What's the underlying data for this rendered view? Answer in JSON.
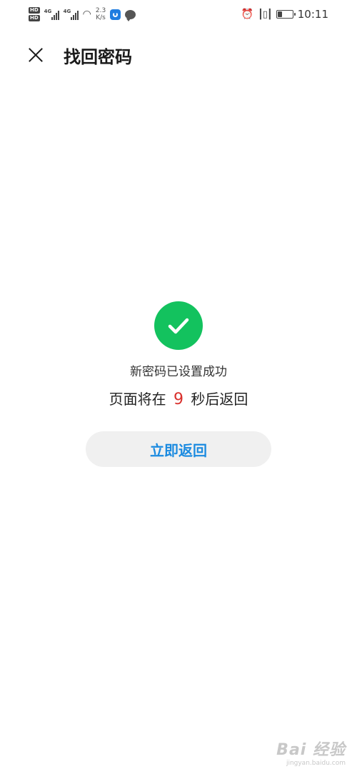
{
  "status_bar": {
    "hd_badges": [
      "HD",
      "HD"
    ],
    "signal_labels": [
      "4G",
      "4G"
    ],
    "speed_value": "2.3",
    "speed_unit": "K/s",
    "battery_level": 0.3,
    "time": "10:11",
    "icons": [
      "hd-icon",
      "signal-icon",
      "wifi-icon",
      "app-notification-icon",
      "chat-icon",
      "alarm-icon",
      "vibrate-icon",
      "battery-icon"
    ]
  },
  "header": {
    "title": "找回密码",
    "close_icon": "close-icon"
  },
  "result": {
    "icon": "check-circle-icon",
    "icon_color": "#13c25e",
    "success_message": "新密码已设置成功",
    "countdown_prefix": "页面将在",
    "countdown_seconds": "9",
    "countdown_suffix": "秒后返回",
    "countdown_color": "#d9302c"
  },
  "actions": {
    "return_label": "立即返回",
    "return_color": "#1c8be0"
  },
  "watermark": {
    "logo": "Bai 经验",
    "url": "jingyan.baidu.com"
  }
}
